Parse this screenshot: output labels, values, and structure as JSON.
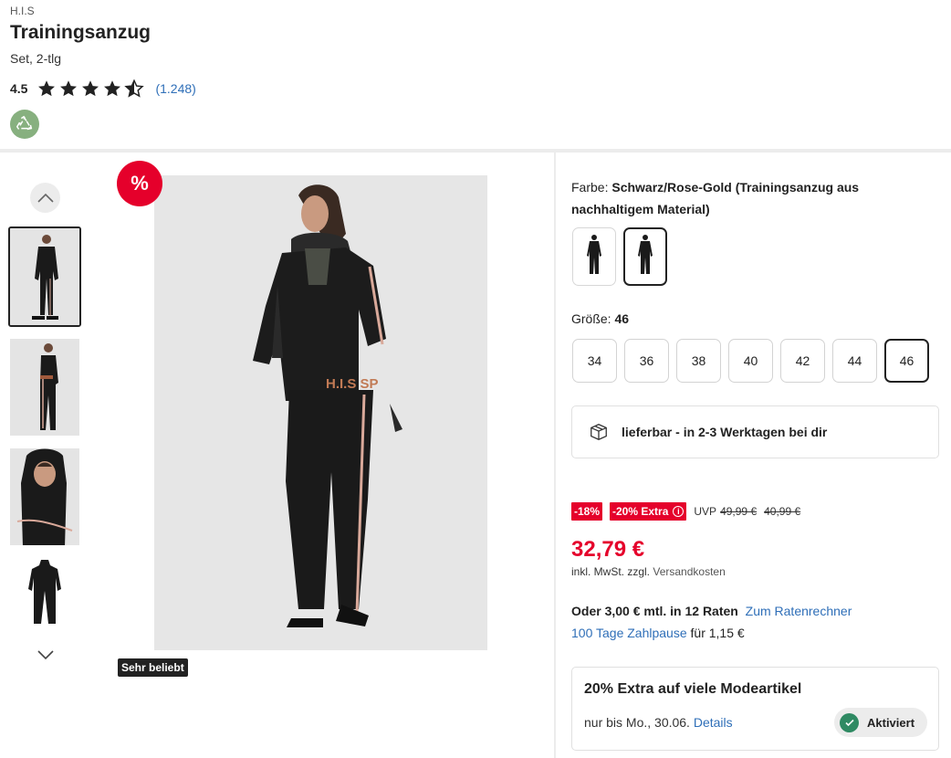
{
  "product": {
    "brand": "H.I.S",
    "title": "Trainingsanzug",
    "subtitle": "Set, 2-tlg",
    "rating": {
      "value": "4.5",
      "stars": 4.5,
      "count": "(1.248)"
    },
    "eco_icon": "recycle-icon"
  },
  "gallery": {
    "sale_badge": "%",
    "popular_tag": "Sehr beliebt",
    "thumbnail_count": 4,
    "active_thumbnail": 1
  },
  "color": {
    "label": "Farbe:",
    "value": "Schwarz/Rose-Gold (Trainingsanzug aus nachhaltigem Material)",
    "selected_swatch": 2
  },
  "size": {
    "label": "Größe:",
    "value": "46",
    "options": [
      "34",
      "36",
      "38",
      "40",
      "42",
      "44",
      "46"
    ],
    "selected": "46"
  },
  "delivery": {
    "icon": "package-icon",
    "text": "lieferbar - in 2-3 Werktagen bei dir"
  },
  "pricing": {
    "discount_badge": "-18%",
    "extra_badge": "-20% Extra",
    "info_icon": "i",
    "uvp_label": "UVP",
    "uvp_price": "49,99 €",
    "old_price": "40,99 €",
    "current_price": "32,79 €",
    "vat_text": "inkl. MwSt. zzgl.",
    "vat_link": "Versandkosten",
    "installment_text": "Oder 3,00 € mtl. in 12 Raten",
    "installment_link": "Zum Ratenrechner",
    "pause_link": "100 Tage Zahlpause",
    "pause_text": "für 1,15 €"
  },
  "promo": {
    "title": "20% Extra auf viele Modeartikel",
    "subtitle": "nur bis Mo., 30.06.",
    "details_link": "Details",
    "status": "Aktiviert"
  },
  "colors": {
    "accent_red": "#e5002b",
    "link_blue": "#2f6fb8",
    "eco_green": "#87b07f",
    "check_green": "#2f8a63"
  }
}
